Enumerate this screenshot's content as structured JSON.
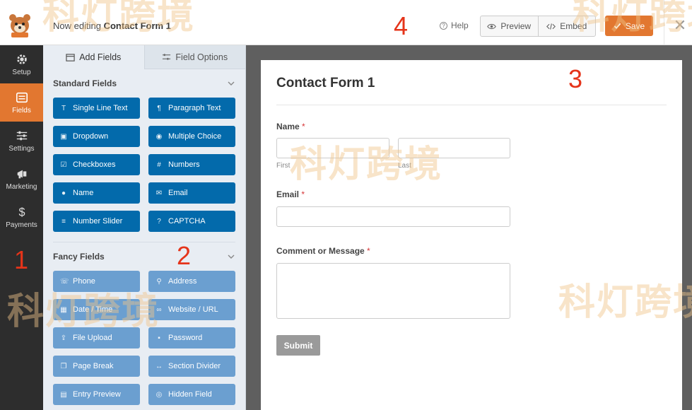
{
  "header": {
    "editing_prefix": "Now editing",
    "form_name": "Contact Form 1",
    "help_label": "Help",
    "preview_label": "Preview",
    "embed_label": "Embed",
    "save_label": "Save",
    "close_label": "✕"
  },
  "sidenav": {
    "items": [
      {
        "label": "Setup",
        "icon": "gear-icon"
      },
      {
        "label": "Fields",
        "icon": "fields-icon"
      },
      {
        "label": "Settings",
        "icon": "sliders-icon"
      },
      {
        "label": "Marketing",
        "icon": "megaphone-icon"
      },
      {
        "label": "Payments",
        "icon": "dollar-icon"
      }
    ]
  },
  "panel": {
    "tabs": [
      {
        "label": "Add Fields"
      },
      {
        "label": "Field Options"
      }
    ],
    "standard_title": "Standard Fields",
    "standard_fields": [
      {
        "label": "Single Line Text",
        "icon": "T"
      },
      {
        "label": "Paragraph Text",
        "icon": "¶"
      },
      {
        "label": "Dropdown",
        "icon": "▣"
      },
      {
        "label": "Multiple Choice",
        "icon": "◉"
      },
      {
        "label": "Checkboxes",
        "icon": "☑"
      },
      {
        "label": "Numbers",
        "icon": "#"
      },
      {
        "label": "Name",
        "icon": "●"
      },
      {
        "label": "Email",
        "icon": "✉"
      },
      {
        "label": "Number Slider",
        "icon": "≡"
      },
      {
        "label": "CAPTCHA",
        "icon": "?"
      }
    ],
    "fancy_title": "Fancy Fields",
    "fancy_fields": [
      {
        "label": "Phone",
        "icon": "☏"
      },
      {
        "label": "Address",
        "icon": "⚲"
      },
      {
        "label": "Date / Time",
        "icon": "▦"
      },
      {
        "label": "Website / URL",
        "icon": "∞"
      },
      {
        "label": "File Upload",
        "icon": "⇪"
      },
      {
        "label": "Password",
        "icon": "▪"
      },
      {
        "label": "Page Break",
        "icon": "❐"
      },
      {
        "label": "Section Divider",
        "icon": "↔"
      },
      {
        "label": "Entry Preview",
        "icon": "▤"
      },
      {
        "label": "Hidden Field",
        "icon": "◎"
      }
    ]
  },
  "form": {
    "title": "Contact Form 1",
    "name_label": "Name",
    "first_sublabel": "First",
    "last_sublabel": "Last",
    "email_label": "Email",
    "comment_label": "Comment or Message",
    "required_mark": "*",
    "submit_label": "Submit"
  },
  "annotations": [
    "1",
    "2",
    "3",
    "4"
  ],
  "watermark": "科灯跨境",
  "colors": {
    "accent": "#e27730",
    "field_button": "#036aab",
    "fancy_button": "#6b9fd0",
    "sidebar": "#2d2d2d",
    "annotation": "#e5341a"
  }
}
